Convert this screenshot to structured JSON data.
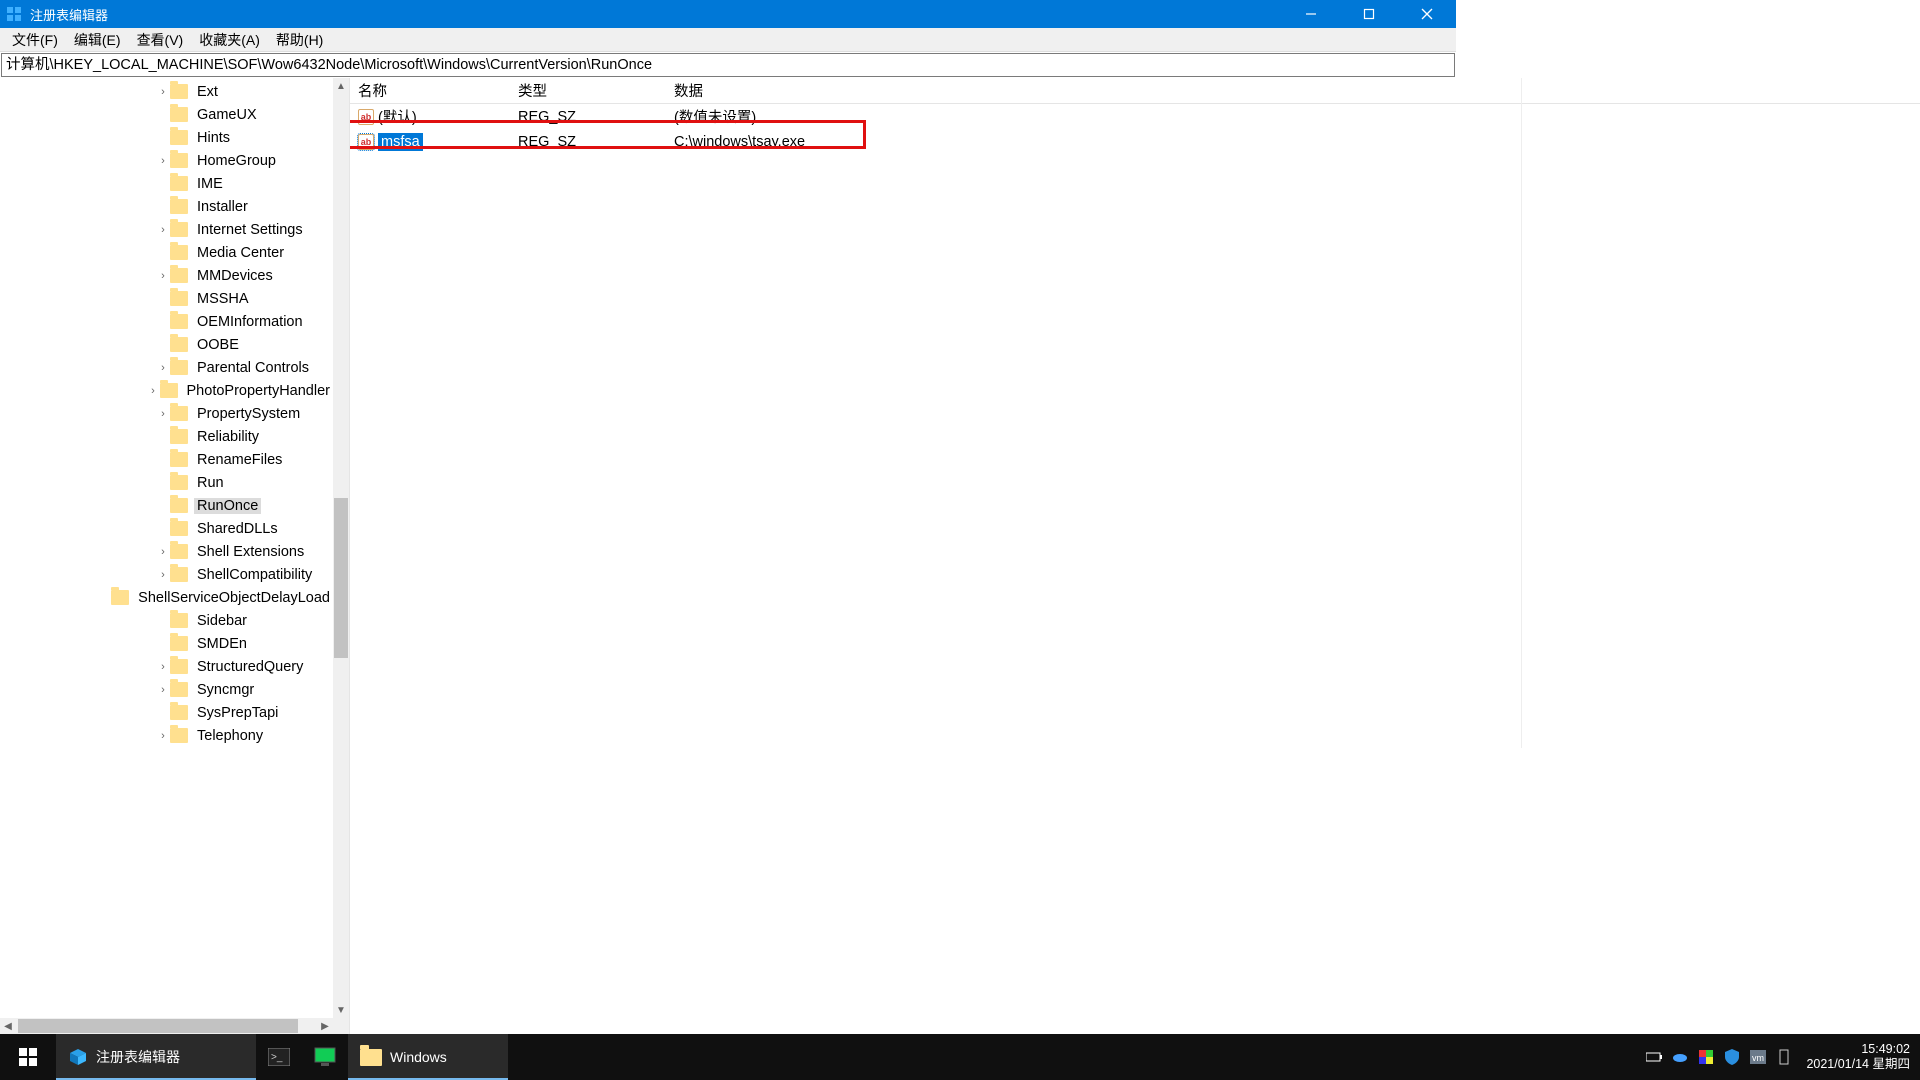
{
  "window": {
    "title": "注册表编辑器"
  },
  "menu": {
    "file": "文件(F)",
    "edit": "编辑(E)",
    "view": "查看(V)",
    "fav": "收藏夹(A)",
    "help": "帮助(H)"
  },
  "path": "计算机\\HKEY_LOCAL_MACHINE\\SOF\\Wow6432Node\\Microsoft\\Windows\\CurrentVersion\\RunOnce",
  "tree": [
    {
      "label": "Ext",
      "expander": "›"
    },
    {
      "label": "GameUX",
      "expander": ""
    },
    {
      "label": "Hints",
      "expander": ""
    },
    {
      "label": "HomeGroup",
      "expander": "›"
    },
    {
      "label": "IME",
      "expander": ""
    },
    {
      "label": "Installer",
      "expander": ""
    },
    {
      "label": "Internet Settings",
      "expander": "›"
    },
    {
      "label": "Media Center",
      "expander": ""
    },
    {
      "label": "MMDevices",
      "expander": "›"
    },
    {
      "label": "MSSHA",
      "expander": ""
    },
    {
      "label": "OEMInformation",
      "expander": ""
    },
    {
      "label": "OOBE",
      "expander": ""
    },
    {
      "label": "Parental Controls",
      "expander": "›"
    },
    {
      "label": "PhotoPropertyHandler",
      "expander": "›"
    },
    {
      "label": "PropertySystem",
      "expander": "›"
    },
    {
      "label": "Reliability",
      "expander": ""
    },
    {
      "label": "RenameFiles",
      "expander": ""
    },
    {
      "label": "Run",
      "expander": ""
    },
    {
      "label": "RunOnce",
      "expander": "",
      "selected": true
    },
    {
      "label": "SharedDLLs",
      "expander": ""
    },
    {
      "label": "Shell Extensions",
      "expander": "›"
    },
    {
      "label": "ShellCompatibility",
      "expander": "›"
    },
    {
      "label": "ShellServiceObjectDelayLoad",
      "expander": ""
    },
    {
      "label": "Sidebar",
      "expander": ""
    },
    {
      "label": "SMDEn",
      "expander": ""
    },
    {
      "label": "StructuredQuery",
      "expander": "›"
    },
    {
      "label": "Syncmgr",
      "expander": "›"
    },
    {
      "label": "SysPrepTapi",
      "expander": ""
    },
    {
      "label": "Telephony",
      "expander": "›"
    }
  ],
  "columns": {
    "name": "名称",
    "type": "类型",
    "data": "数据"
  },
  "values": [
    {
      "name": "(默认)",
      "type": "REG_SZ",
      "data": "(数值未设置)",
      "selected": false
    },
    {
      "name": "msfsa",
      "type": "REG_SZ",
      "data": "C:\\windows\\tsay.exe",
      "selected": true
    }
  ],
  "taskbar": {
    "app1": "注册表编辑器",
    "app2": "",
    "app3": "",
    "app4": "Windows",
    "time": "15:49:02",
    "date": "2021/01/14 星期四"
  }
}
